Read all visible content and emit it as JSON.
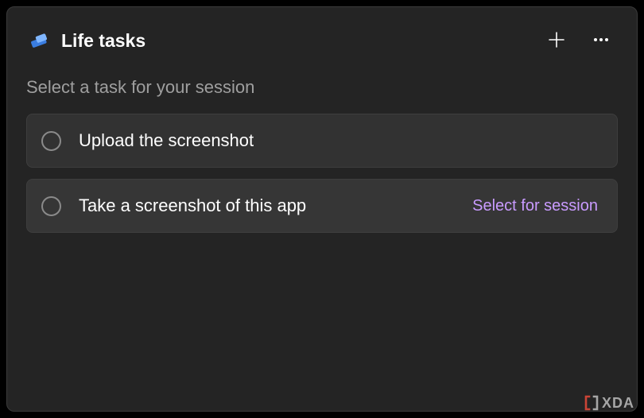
{
  "header": {
    "title": "Life tasks"
  },
  "subtitle": "Select a task for your session",
  "tasks": [
    {
      "label": "Upload the screenshot"
    },
    {
      "label": "Take a screenshot of this app",
      "action": "Select for session"
    }
  ],
  "watermark": {
    "text": "XDA"
  }
}
